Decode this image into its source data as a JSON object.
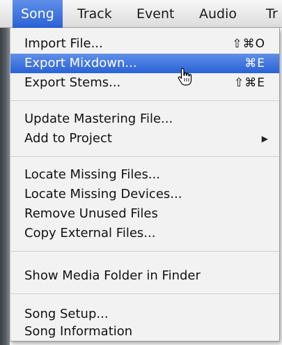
{
  "menubar": {
    "items": [
      {
        "label": "Song",
        "active": true
      },
      {
        "label": "Track"
      },
      {
        "label": "Event"
      },
      {
        "label": "Audio"
      },
      {
        "label": "Tr"
      }
    ]
  },
  "menu": {
    "groups": [
      {
        "items": [
          {
            "label": "Import File...",
            "shortcut": "⇧⌘O"
          },
          {
            "label": "Export Mixdown...",
            "shortcut": "⌘E",
            "highlighted": true
          },
          {
            "label": "Export Stems...",
            "shortcut": "⇧⌘E"
          }
        ]
      },
      {
        "items": [
          {
            "label": "Update Mastering File..."
          },
          {
            "label": "Add to Project",
            "submenu_icon": "triangle-right-icon"
          }
        ]
      },
      {
        "items": [
          {
            "label": "Locate Missing Files..."
          },
          {
            "label": "Locate Missing Devices..."
          },
          {
            "label": "Remove Unused Files"
          },
          {
            "label": "Copy External Files..."
          }
        ]
      },
      {
        "items": [
          {
            "label": "Show Media Folder in Finder"
          }
        ]
      },
      {
        "items": [
          {
            "label": "Song Setup..."
          },
          {
            "label": "Song Information"
          }
        ]
      }
    ]
  },
  "colors": {
    "highlight": "#2f66d8",
    "menu_bg": "#f2f2f2"
  }
}
